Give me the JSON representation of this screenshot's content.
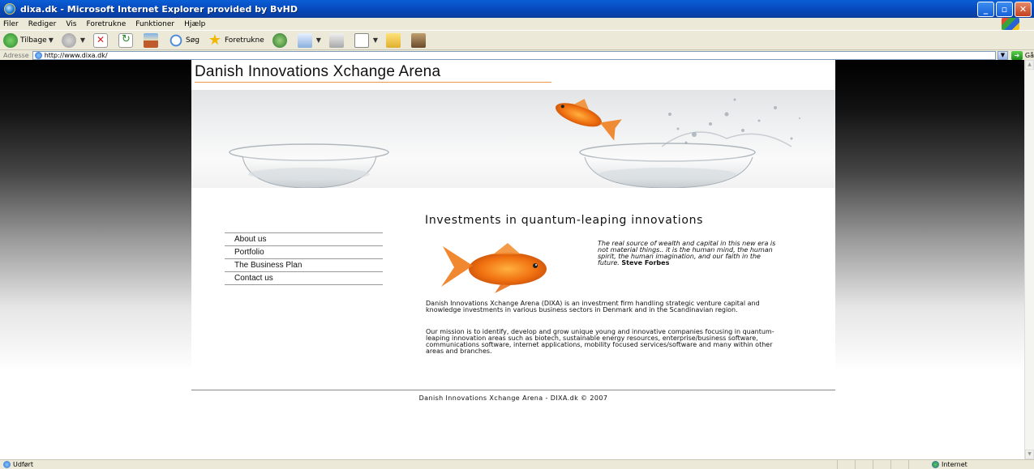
{
  "window": {
    "title": "dixa.dk - Microsoft Internet Explorer provided by BvHD",
    "minimize": "_",
    "maximize": "▫",
    "close": "✕"
  },
  "menu": [
    "Filer",
    "Rediger",
    "Vis",
    "Foretrukne",
    "Funktioner",
    "Hjælp"
  ],
  "toolbar": {
    "back": "Tilbage",
    "search": "Søg",
    "favorites": "Foretrukne"
  },
  "address": {
    "label": "Adresse",
    "url": "http://www.dixa.dk/",
    "go": "Gå"
  },
  "page": {
    "logo": "Danish Innovations Xchange Arena",
    "nav": [
      "About us",
      "Portfolio",
      "The Business Plan",
      "Contact us"
    ],
    "headline": "Investments in quantum-leaping innovations",
    "quote": "The real source of wealth and capital in this new era is not material things.. it is the human mind, the human spirit, the human imagination, and our faith in the future.",
    "quote_author": "Steve Forbes",
    "para1": "Danish Innovations Xchange Arena (DIXA) is an investment firm handling strategic venture capital and knowledge investments in various business sectors in Denmark and in the Scandinavian region.",
    "para2": "Our mission is to identify, develop and grow unique young and innovative companies focusing in quantum-leaping innovation areas such as biotech, sustainable energy resources, enterprise/business software, communications software, internet applications, mobility focused services/software and many within other areas and branches.",
    "footer": "Danish Innovations Xchange Arena - DIXA.dk © 2007"
  },
  "status": {
    "text": "Udført",
    "zone": "Internet"
  }
}
